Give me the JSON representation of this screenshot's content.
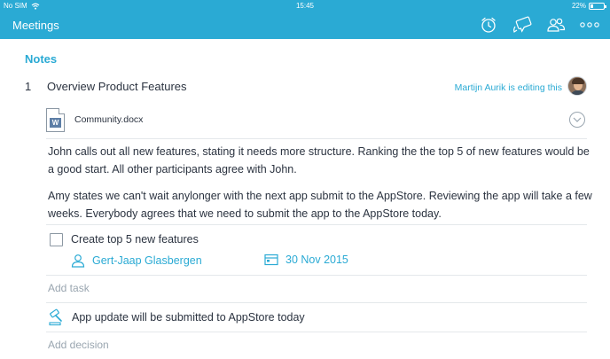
{
  "status_bar": {
    "carrier": "No SIM",
    "time": "15:45",
    "battery": "22%"
  },
  "header": {
    "title": "Meetings",
    "icons": [
      "alarm-clock-icon",
      "chat-bubbles-icon",
      "people-icon",
      "more-icon"
    ],
    "bg_color": "#2aaad4"
  },
  "notes": {
    "section_title": "Notes",
    "topic": {
      "number": "1",
      "title": "Overview Product Features",
      "editing_status": "Martijn Aurik is editing this"
    },
    "attachment": {
      "name": "Community.docx",
      "icon": "word-document-icon"
    },
    "paragraphs": [
      "John calls out all new features, stating it needs more structure. Ranking the the top 5 of new features would be a good start. All other participants agree with John.",
      "Amy states we can't wait anylonger with the next app submit to the AppStore. Reviewing the app will take a few weeks. Everybody agrees that we need to submit the app to the AppStore today."
    ]
  },
  "task": {
    "checked": false,
    "label": "Create top 5 new features",
    "assignee": "Gert-Jaap Glasbergen",
    "due_date": "30 Nov 2015"
  },
  "add_task_label": "Add task",
  "decision": {
    "label": "App update will be submitted to AppStore today",
    "icon": "gavel-icon"
  },
  "add_decision_label": "Add decision",
  "accent_color": "#2aaad4"
}
